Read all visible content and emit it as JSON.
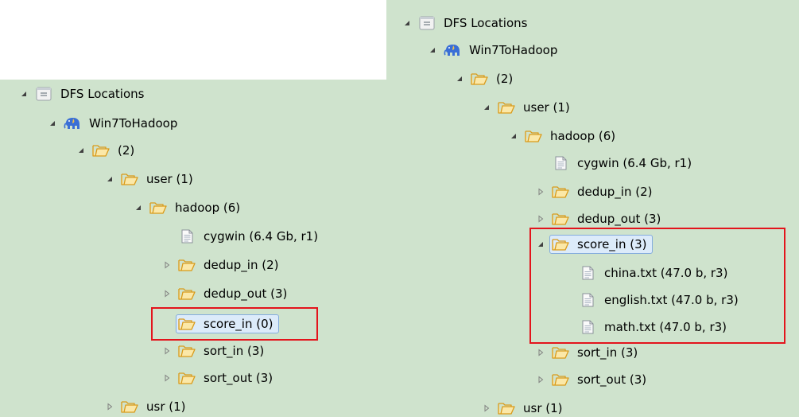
{
  "left_tree": {
    "root": "DFS Locations",
    "server": "Win7ToHadoop",
    "dir_root": "(2)",
    "user": "user (1)",
    "hadoop": "hadoop (6)",
    "cygwin": "cygwin (6.4 Gb, r1)",
    "dedup_in": "dedup_in (2)",
    "dedup_out": "dedup_out (3)",
    "score_in": "score_in (0)",
    "sort_in": "sort_in (3)",
    "sort_out": "sort_out (3)",
    "usr": "usr (1)"
  },
  "right_tree": {
    "root": "DFS Locations",
    "server": "Win7ToHadoop",
    "dir_root": "(2)",
    "user": "user (1)",
    "hadoop": "hadoop (6)",
    "cygwin": "cygwin (6.4 Gb, r1)",
    "dedup_in": "dedup_in (2)",
    "dedup_out": "dedup_out (3)",
    "score_in": "score_in (3)",
    "china": "china.txt (47.0 b, r3)",
    "english": "english.txt (47.0 b, r3)",
    "math": "math.txt (47.0 b, r3)",
    "sort_in": "sort_in (3)",
    "sort_out": "sort_out (3)",
    "usr": "usr (1)"
  },
  "icons": {
    "expanded": "triangle-expanded-icon",
    "collapsed": "triangle-collapsed-icon",
    "folder": "folder-icon",
    "file": "file-icon",
    "dfs": "dfs-locations-icon",
    "server": "hadoop-elephant-icon"
  },
  "colors": {
    "panel_bg": "#cfe3cd",
    "highlight_box": "#e3141c",
    "selection_bg": "#dcebfa"
  }
}
